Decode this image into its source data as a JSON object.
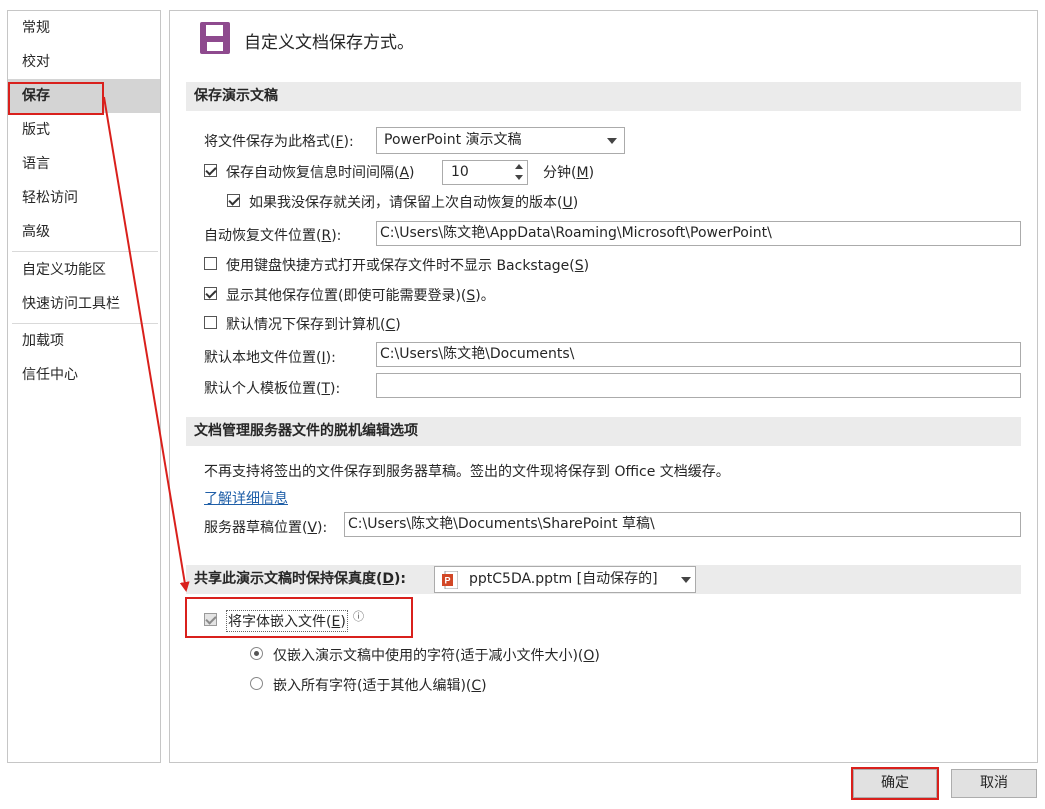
{
  "nav": {
    "items": [
      "常规",
      "校对",
      "保存",
      "版式",
      "语言",
      "轻松访问",
      "高级",
      "自定义功能区",
      "快速访问工具栏",
      "加载项",
      "信任中心"
    ],
    "selected": "保存"
  },
  "header": {
    "title": "自定义文档保存方式。",
    "icon": "save-floppy-icon",
    "icon_color": "#8e4a8e"
  },
  "save_section": {
    "heading": "保存演示文稿",
    "format": {
      "label_pre": "将文件保存为此格式(",
      "key": "F",
      "label_post": "):",
      "value": "PowerPoint 演示文稿"
    },
    "autorecover": {
      "label_pre": "保存自动恢复信息时间间隔(",
      "key": "A",
      "label_post": ")",
      "checked": true,
      "value": "10",
      "unit_pre": "分钟(",
      "unit_key": "M",
      "unit_post": ")"
    },
    "keep_last": {
      "label_pre": "如果我没保存就关闭，请保留上次自动恢复的版本(",
      "key": "U",
      "label_post": ")",
      "checked": true
    },
    "autorecover_location": {
      "label_pre": "自动恢复文件位置(",
      "key": "R",
      "label_post": "):",
      "value": "C:\\Users\\陈文艳\\AppData\\Roaming\\Microsoft\\PowerPoint\\"
    },
    "no_backstage": {
      "label_pre": "使用键盘快捷方式打开或保存文件时不显示 Backstage(",
      "key": "S",
      "label_post": ")",
      "checked": false
    },
    "show_locations": {
      "label_pre": "显示其他保存位置(即使可能需要登录)(",
      "key": "S",
      "label_post": ")。",
      "checked": true
    },
    "save_to_computer": {
      "label_pre": "默认情况下保存到计算机(",
      "key": "C",
      "label_post": ")",
      "checked": false
    },
    "local_location": {
      "label_pre": "默认本地文件位置(",
      "key": "I",
      "label_post": "):",
      "value": "C:\\Users\\陈文艳\\Documents\\"
    },
    "template_location": {
      "label_pre": "默认个人模板位置(",
      "key": "T",
      "label_post": "):",
      "value": ""
    }
  },
  "offline_section": {
    "heading": "文档管理服务器文件的脱机编辑选项",
    "notice": "不再支持将签出的文件保存到服务器草稿。签出的文件现将保存到 Office 文档缓存。",
    "learn_more": "了解详细信息",
    "drafts_location": {
      "label_pre": "服务器草稿位置(",
      "key": "V",
      "label_post": "):",
      "value": "C:\\Users\\陈文艳\\Documents\\SharePoint 草稿\\"
    }
  },
  "fidelity_section": {
    "heading_pre": "共享此演示文稿时保持保真度(",
    "key": "D",
    "heading_post": "):",
    "file": "pptC5DA.pptm [自动保存的]",
    "embed_fonts": {
      "label_pre": "将字体嵌入文件(",
      "key": "E",
      "label_post": ")",
      "checked": true,
      "disabled": true,
      "info_icon": "ⓘ"
    },
    "embed_used": {
      "label_pre": "仅嵌入演示文稿中使用的字符(适于减小文件大小)(",
      "key": "O",
      "label_post": ")",
      "selected": true
    },
    "embed_all": {
      "label_pre": "嵌入所有字符(适于其他人编辑)(",
      "key": "C",
      "label_post": ")",
      "selected": false
    }
  },
  "buttons": {
    "ok": "确定",
    "cancel": "取消"
  },
  "annotation_color": "#d9201c"
}
